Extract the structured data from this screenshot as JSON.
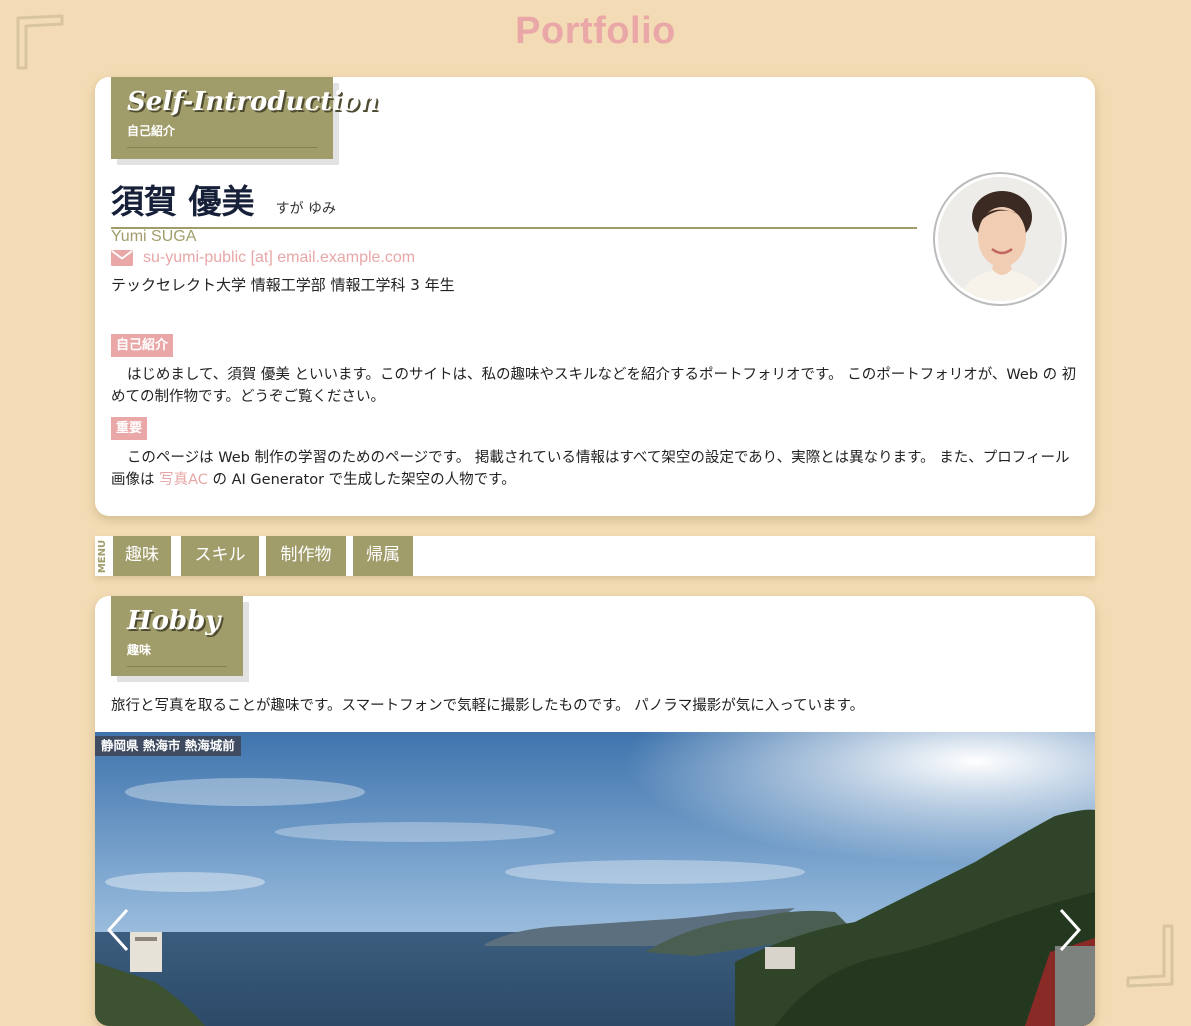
{
  "site": {
    "title": "Portfolio"
  },
  "intro_section": {
    "heading_en": "Self-Introduction",
    "heading_ja": "自己紹介",
    "name_kanji": "須賀 優美",
    "name_kana": "すが ゆみ",
    "name_en": "Yumi SUGA",
    "email": "su-yumi-public [at] email.example.com",
    "affiliation": "テックセレクト大学 情報工学部 情報工学科 3 年生",
    "tag_intro": "自己紹介",
    "intro_text": "はじめまして、須賀 優美 といいます。このサイトは、私の趣味やスキルなどを紹介するポートフォリオです。 このポートフォリオが、Web の 初めての制作物です。どうぞご覧ください。",
    "tag_important": "重要",
    "important_text_before": "このページは Web 制作の学習のためのページです。 掲載されている情報はすべて架空の設定であり、実際とは異なります。 また、プロフィール画像は ",
    "important_link": "写真AC",
    "important_text_after": " の AI Generator で生成した架空の人物です。"
  },
  "menu": {
    "label": "MENU",
    "items": [
      {
        "label": "趣味"
      },
      {
        "label": "スキル"
      },
      {
        "label": "制作物"
      },
      {
        "label": "帰属"
      }
    ]
  },
  "hobby_section": {
    "heading_en": "Hobby",
    "heading_ja": "趣味",
    "text": "旅行と写真を取ることが趣味です。スマートフォンで気軽に撮影したものです。 パノラマ撮影が気に入っています。",
    "photo_caption": "静岡県 熱海市 熱海城前"
  },
  "colors": {
    "background": "#f3dcb5",
    "accent_olive": "#a19d6b",
    "accent_pink": "#eaa7a7",
    "name_navy": "#172039"
  },
  "icons": {
    "email": "mail-icon",
    "prev": "chevron-left-icon",
    "next": "chevron-right-icon"
  }
}
